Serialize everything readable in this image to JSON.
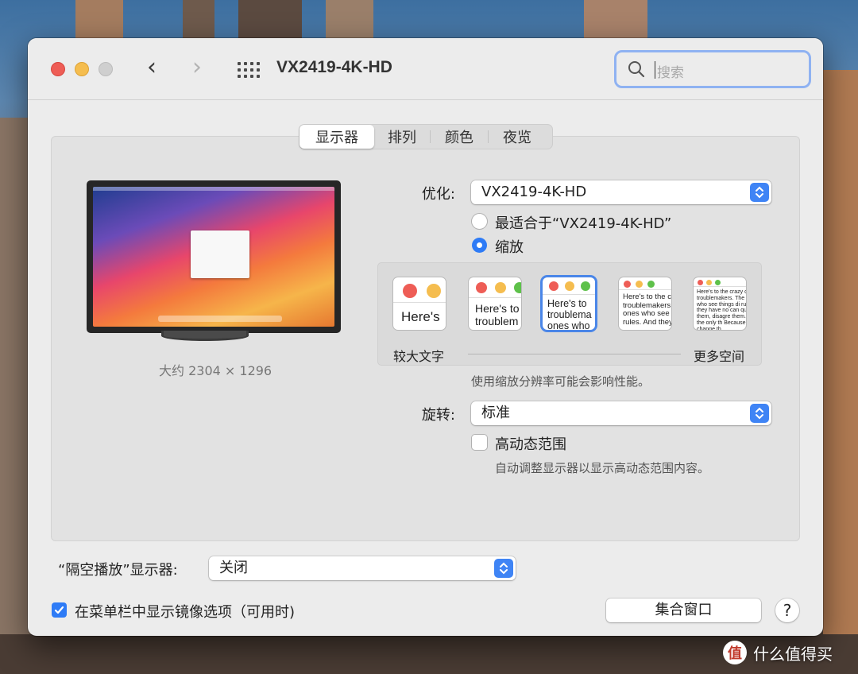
{
  "window": {
    "title": "VX2419-4K-HD",
    "search_placeholder": "搜索",
    "nav_back": "‹",
    "nav_forward": "›"
  },
  "tabs": [
    {
      "label": "显示器",
      "active": true
    },
    {
      "label": "排列",
      "active": false
    },
    {
      "label": "颜色",
      "active": false
    },
    {
      "label": "夜览",
      "active": false
    }
  ],
  "display": {
    "resolution_label": "大约 2304 × 1296",
    "optimize_label": "优化:",
    "optimize_value": "VX2419-4K-HD",
    "radio_best": "最适合于“VX2419-4K-HD”",
    "radio_scaled": "缩放",
    "scaled_selected": true,
    "scale_options": [
      "Here's",
      "Here's to troublem",
      "Here's to troublema ones who",
      "Here's to the cr troublemakers. ones who see t rules. And they",
      "Here's to the crazy ones troublemakers. The rou ones who see things di rules. And they have no can quote them, disagre them. About the only th Because they change th"
    ],
    "scale_selected_index": 2,
    "scale_left_label": "较大文字",
    "scale_right_label": "更多空间",
    "scale_note": "使用缩放分辨率可能会影响性能。",
    "rotation_label": "旋转:",
    "rotation_value": "标准",
    "hdr_label": "高动态范围",
    "hdr_checked": false,
    "hdr_note": "自动调整显示器以显示高动态范围内容。"
  },
  "footer": {
    "airplay_label": "“隔空播放”显示器:",
    "airplay_value": "关闭",
    "mirror_label": "在菜单栏中显示镜像选项（可用时)",
    "mirror_checked": true,
    "gather_button": "集合窗口",
    "help_button": "?"
  },
  "watermark": {
    "logo_text": "值",
    "text": "什么值得买"
  },
  "colors": {
    "accent": "#2e7bf6",
    "close": "#ee5d56",
    "minimize": "#f5bd4f",
    "selection_ring": "#4a86e8"
  }
}
